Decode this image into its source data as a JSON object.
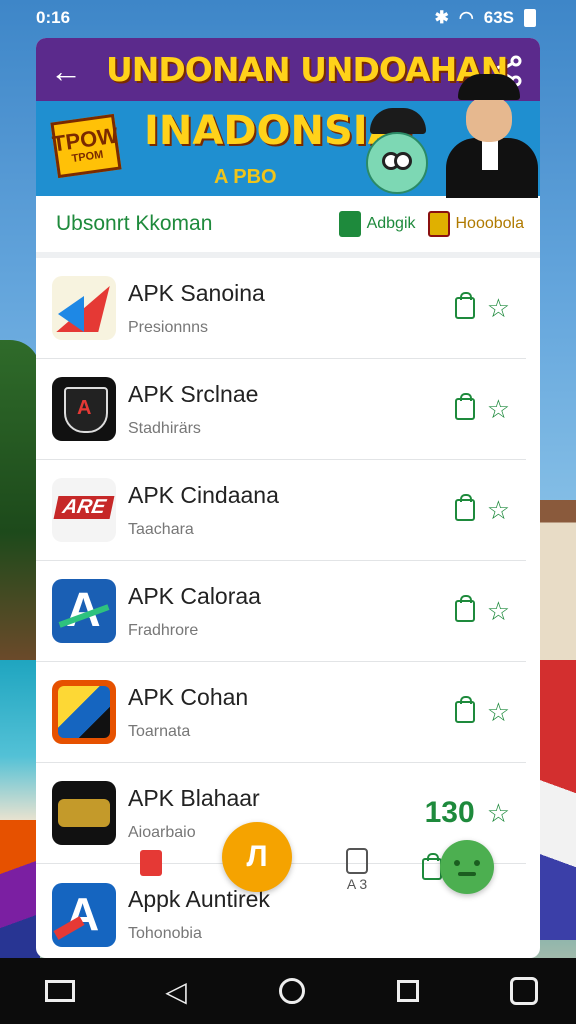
{
  "status_bar": {
    "time": "0:16",
    "right": "63S"
  },
  "banner": {
    "title": "UNDONAN UNDOAHAN",
    "subtitle": "INADONSIA!",
    "tagline": "A PBO",
    "badge_line1": "TPOW",
    "badge_line2": "TPOM"
  },
  "header": {
    "title": "Ubsonrt Kkoman",
    "badge1": "Adbgik",
    "badge2": "Hooobola"
  },
  "apps": [
    {
      "title": "APK Sanoina",
      "subtitle": "Presionnns"
    },
    {
      "title": "APK Srclnae",
      "subtitle": "Stadhirärs"
    },
    {
      "title": "APK Cindaana",
      "subtitle": "Taachara"
    },
    {
      "title": "APK Caloraa",
      "subtitle": "Fradhrore"
    },
    {
      "title": "APK Cohan",
      "subtitle": "Toarnata"
    },
    {
      "title": "APK Blahaar",
      "subtitle": "Aioarbaio",
      "count": "130"
    },
    {
      "title": "Appk Auntirek",
      "subtitle": "Tohonobia"
    }
  ],
  "overlay": {
    "fab_label": "Л",
    "device_label": "A 3"
  },
  "colors": {
    "accent": "#1e8a3c",
    "fab": "#f5a300",
    "banner_purple": "#5b2a8c",
    "banner_title": "#ffd21a"
  }
}
